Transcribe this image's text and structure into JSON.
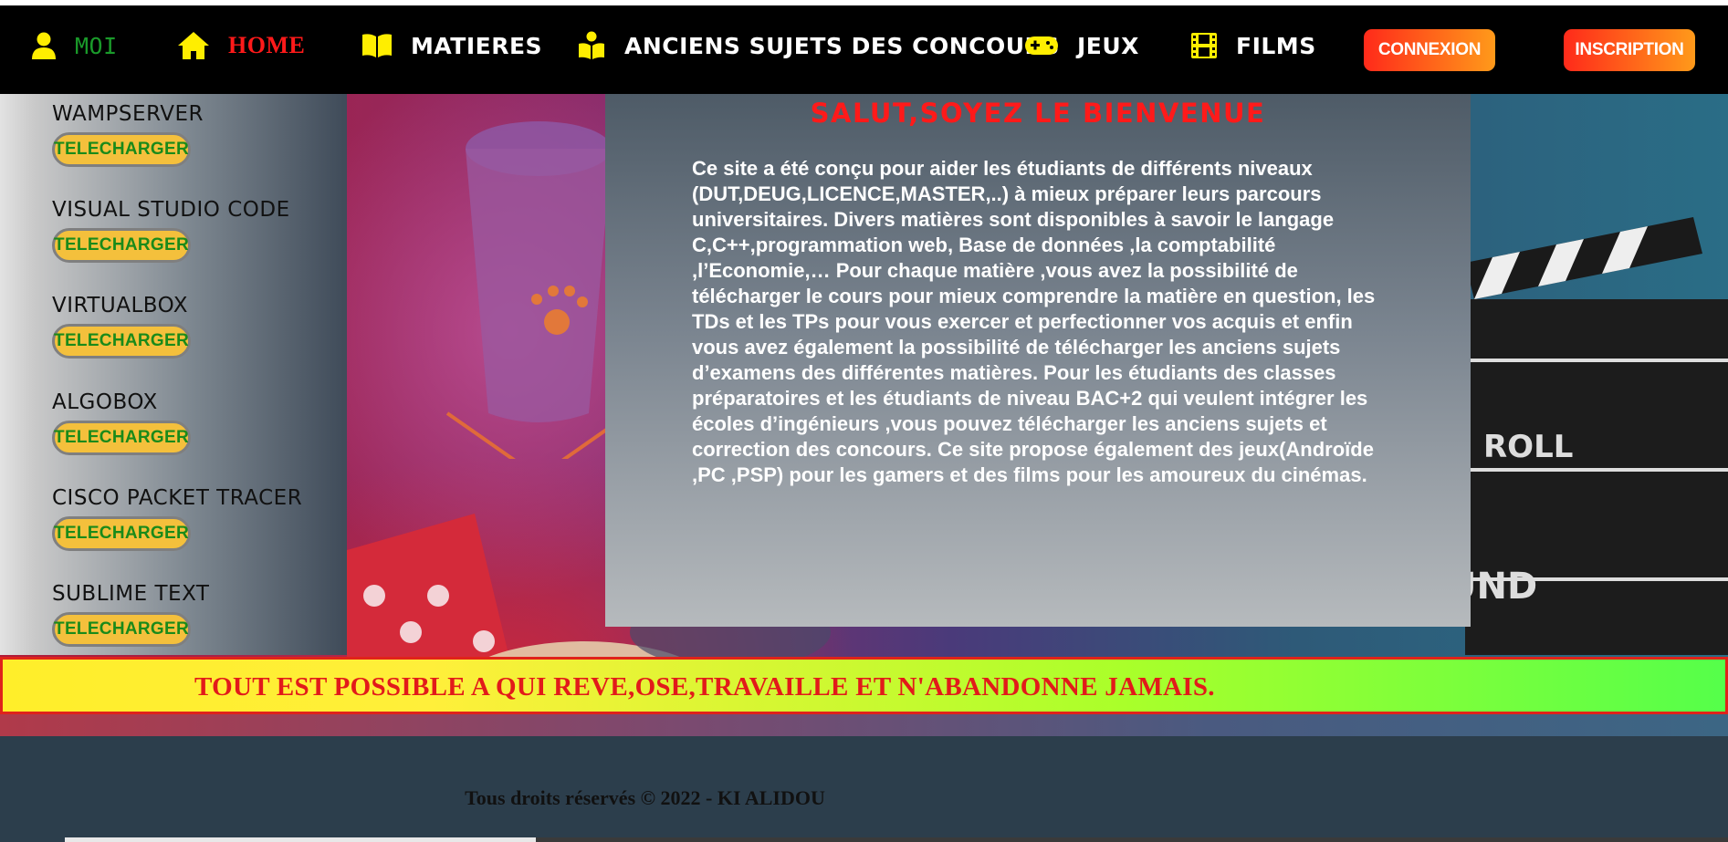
{
  "nav": {
    "moi": "MOI",
    "home": "HOME",
    "matieres": "MATIERES",
    "anciens": "ANCIENS SUJETS DES CONCOURS",
    "jeux": "JEUX",
    "films": "FILMS",
    "connexion": "CONNEXION",
    "inscription": "INSCRIPTION",
    "icons": [
      "user-icon",
      "home-icon",
      "book-icon",
      "reader-icon",
      "gamepad-icon",
      "film-icon"
    ]
  },
  "sidebar": {
    "items": [
      {
        "title": "WAMPSERVER",
        "button": "TELECHARGER"
      },
      {
        "title": "VISUAL STUDIO CODE",
        "button": "TELECHARGER"
      },
      {
        "title": "VIRTUALBOX",
        "button": "TELECHARGER"
      },
      {
        "title": "ALGOBOX",
        "button": "TELECHARGER"
      },
      {
        "title": "CISCO PACKET TRACER",
        "button": "TELECHARGER"
      },
      {
        "title": "SUBLIME TEXT",
        "button": "TELECHARGER"
      }
    ]
  },
  "welcome": {
    "title": "SALUT,SOYEZ LE BIENVENUE",
    "text": "Ce site a été conçu pour aider les étudiants de différents niveaux (DUT,DEUG,LICENCE,MASTER,..) à mieux préparer leurs parcours universitaires. Divers matières sont disponibles à savoir le langage C,C++,programmation web, Base de données ,la comptabilité ,l’Economie,… Pour chaque matière ,vous avez la possibilité de télécharger le cours pour mieux comprendre la matière en question, les TDs et les TPs pour vous exercer et perfectionner vos acquis et enfin vous avez également la possibilité de télécharger les anciens sujets d’examens des différentes matières. Pour les étudiants des classes préparatoires et les étudiants de niveau BAC+2 qui veulent intégrer les écoles d’ingénieurs ,vous pouvez télécharger les anciens sujets et correction des concours. Ce site propose également des jeux(Androïde ,PC ,PSP) pour les gamers et des films pour les amoureux du cinémas."
  },
  "background": {
    "clapper_text_1": "ROLL",
    "clapper_text_2": "UND"
  },
  "motto": "TOUT EST POSSIBLE A QUI REVE,OSE,TRAVAILLE ET N'ABANDONNE JAMAIS.",
  "footer": "Tous droits réservés © 2022 - KI ALIDOU",
  "colors": {
    "nav_bg": "#000000",
    "home_active": "#ff1a1a",
    "moi": "#1a9a2a",
    "button_gradient_start": "#ff2a1a",
    "button_gradient_end": "#ff9a1a",
    "download_bg": "#f4c03c",
    "download_text": "#1a8a1a",
    "welcome_title": "#ff1a1a",
    "motto_text": "#e21a1a",
    "footer_bg": "#2c3e4c"
  }
}
